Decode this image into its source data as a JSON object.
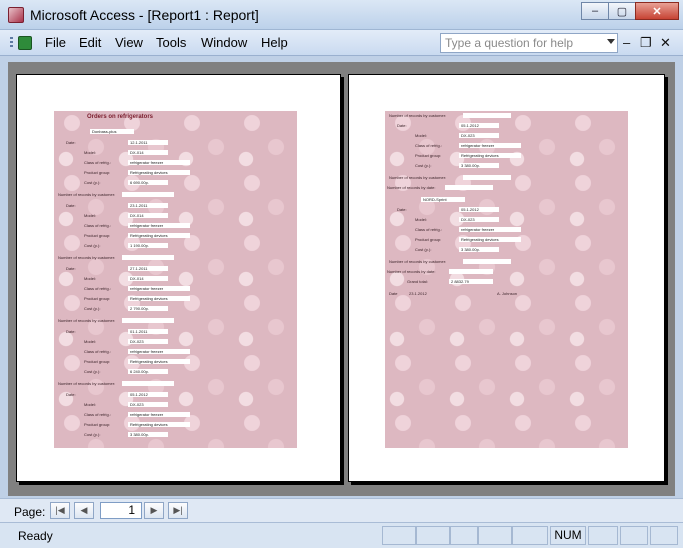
{
  "window": {
    "title": "Microsoft Access - [Report1 : Report]",
    "minimize_glyph": "‒",
    "maximize_glyph": "▢",
    "close_glyph": "✕"
  },
  "menu": {
    "items": [
      "File",
      "Edit",
      "View",
      "Tools",
      "Window",
      "Help"
    ],
    "ask_placeholder": "Type a question for help",
    "mdi_minimize": "–",
    "mdi_restore": "❐",
    "mdi_close": "✕"
  },
  "report": {
    "page1": {
      "title": "Orders on refrigerators",
      "customer_label": "Customer",
      "customer_value": "Donbass-plus",
      "orders": [
        {
          "date": "12.1.2011",
          "model": "DX-014",
          "class": "refrigerator freezer",
          "group": "Refrigerating devices",
          "cost": "6 690.00p."
        },
        {
          "date": "23.1.2011",
          "model": "DX-014",
          "class": "refrigerator freezer",
          "group": "Refrigerating devices",
          "cost": "1 190.00p."
        },
        {
          "date": "27.1.2011",
          "model": "DX-014",
          "class": "refrigerator freezer",
          "group": "Refrigerating devices",
          "cost": "2 790.00p."
        },
        {
          "date": "01.1.2011",
          "model": "DX-023",
          "class": "refrigerator freezer",
          "group": "Refrigerating devices",
          "cost": "6 240.00p."
        },
        {
          "date": "05.1.2012",
          "model": "DX-023",
          "class": "refrigerator freezer",
          "group": "Refrigerating devices",
          "cost": "3 380.00p."
        }
      ]
    },
    "page2": {
      "customer_value": "NORD-Sprint",
      "date_value": "23.1.2012",
      "signature": "A. Johnson",
      "grand_total": "2 8832.79"
    },
    "labels": {
      "number_by_customer": "Number of records by customer:",
      "date": "Date:",
      "model": "Model:",
      "class": "Class of refrig.:",
      "group": "Product group:",
      "cost": "Cost (p.):",
      "number_by_date": "Number of records by date:",
      "grand_total": "Grand total:",
      "date_footer": "Date"
    }
  },
  "navigation": {
    "label": "Page:",
    "first": "|◀",
    "prev": "◀",
    "current_page": "1",
    "next": "▶",
    "last": "▶|"
  },
  "status": {
    "text": "Ready",
    "num": "NUM"
  }
}
